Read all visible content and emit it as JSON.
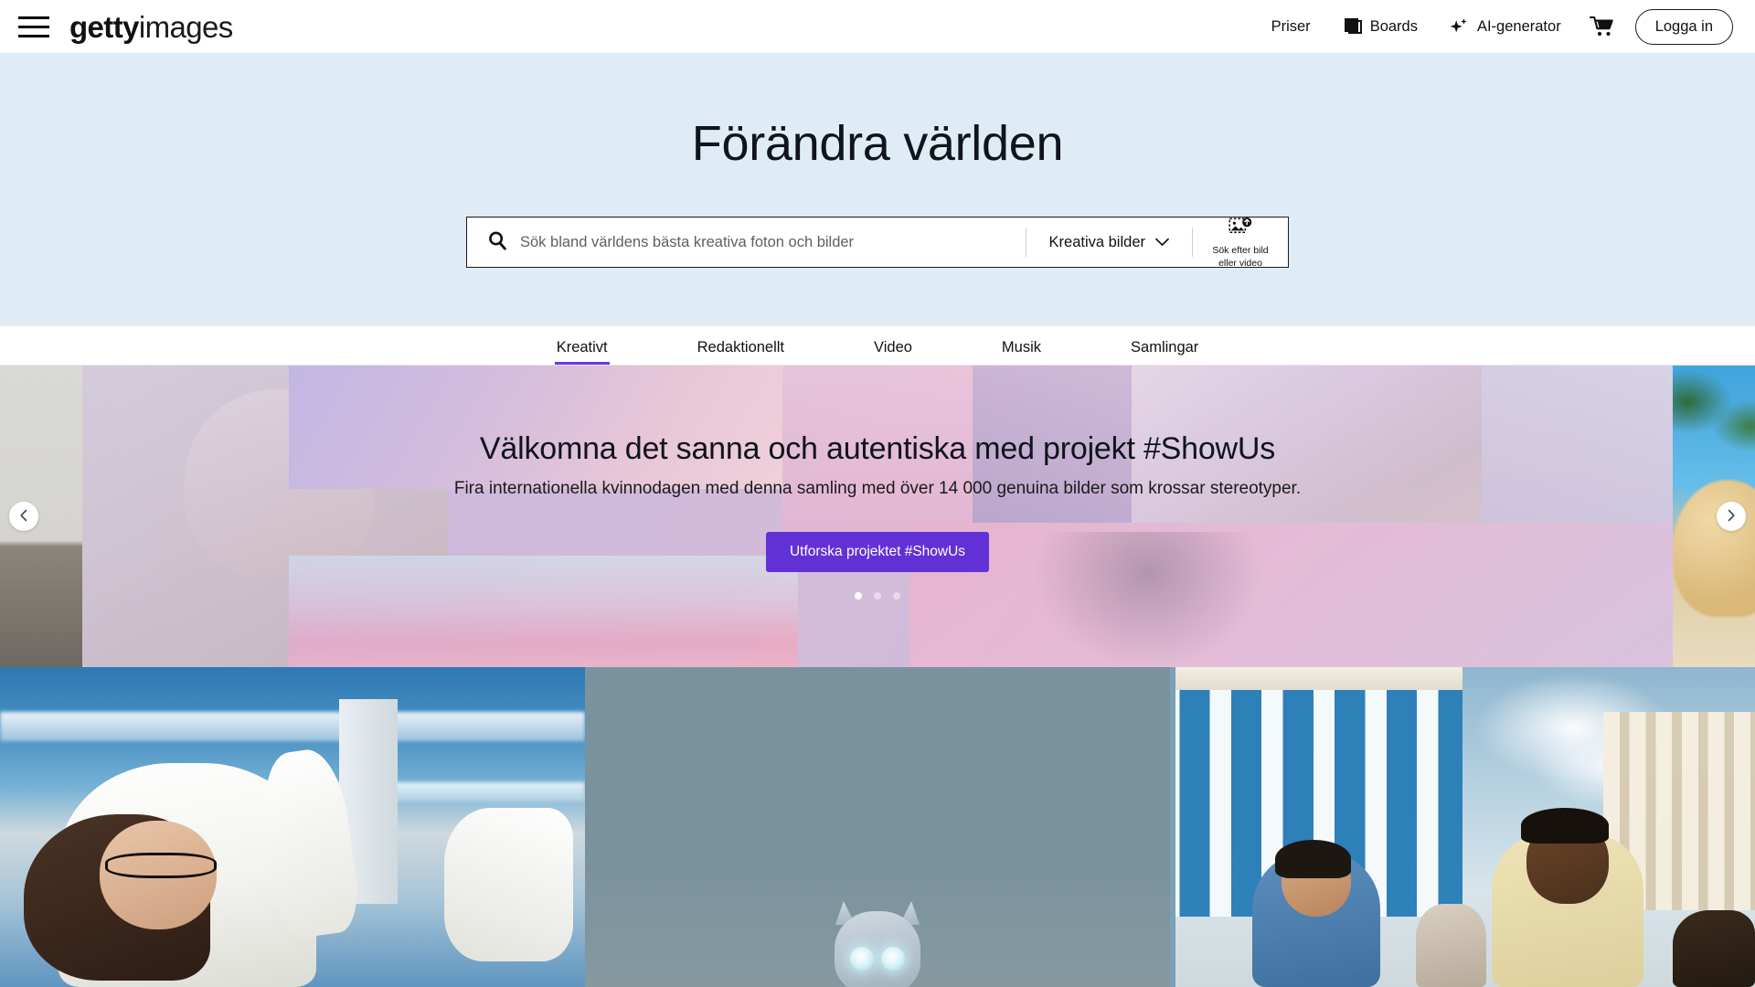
{
  "header": {
    "menu_label": "Menu",
    "logo": {
      "bold": "getty",
      "regular": "images"
    },
    "nav": [
      {
        "label": "Priser",
        "icon": ""
      },
      {
        "label": "Boards",
        "icon": "boards-icon"
      },
      {
        "label": "AI-generator",
        "icon": "sparkle-icon"
      }
    ],
    "cart_icon": "cart-icon",
    "signin_label": "Logga in"
  },
  "hero": {
    "title": "Förändra världen",
    "background_color": "#e0ecf5",
    "search": {
      "placeholder": "Sök bland världens bästa kreativa foton och bilder",
      "value": "",
      "search_icon": "search-icon",
      "type_selector": "Kreativa bilder",
      "chevron_icon": "chevron-down-icon",
      "visual_search_icon": "image-upload-icon",
      "visual_search_label_line1": "Sök efter bild",
      "visual_search_label_line2": "eller video"
    }
  },
  "tabs": {
    "items": [
      {
        "label": "Kreativt",
        "active": true
      },
      {
        "label": "Redaktionellt",
        "active": false
      },
      {
        "label": "Video",
        "active": false
      },
      {
        "label": "Musik",
        "active": false
      },
      {
        "label": "Samlingar",
        "active": false
      }
    ],
    "active_underline_color": "#6a3be4"
  },
  "carousel": {
    "prev_icon": "chevron-left-icon",
    "next_icon": "chevron-right-icon",
    "slide": {
      "title": "Välkomna det sanna och autentiska med projekt #ShowUs",
      "subtitle": "Fira internationella kvinnodagen med denna samling med över 14 000 genuina bilder som krossar stereotyper.",
      "cta_label": "Utforska projektet #ShowUs",
      "cta_color": "#6231d6"
    },
    "dots": {
      "count": 3,
      "active_index": 0
    }
  },
  "triptych": {
    "panels": [
      {
        "name": "karate-girl-photo"
      },
      {
        "name": "robot-character-photo"
      },
      {
        "name": "street-friends-photo"
      }
    ]
  }
}
